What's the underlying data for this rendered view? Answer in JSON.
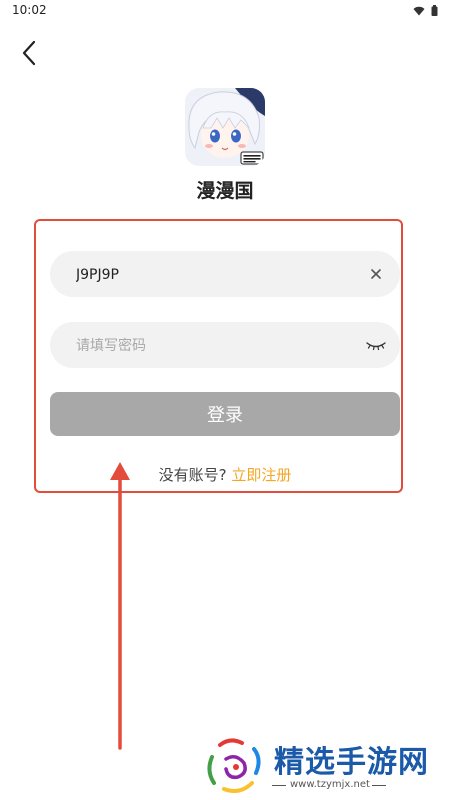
{
  "status_bar": {
    "time": "10:02",
    "icons": [
      "wifi-icon",
      "battery-icon"
    ]
  },
  "nav": {
    "back_icon": "chevron-left-icon"
  },
  "app": {
    "name": "漫漫国",
    "logo_badge": "漫漫国"
  },
  "login_form": {
    "account_value": "J9PJ9P",
    "password_placeholder": "请填写密码",
    "login_label": "登录",
    "no_account_text": "没有账号?",
    "register_label": "立即注册"
  },
  "annotation": {
    "box_color": "#e34b3b",
    "arrow_color": "#e34b3b"
  },
  "watermark": {
    "title": "精选手游网",
    "url": "www.tzymjx.net"
  },
  "colors": {
    "accent": "#f5a623",
    "button_disabled": "#a8a8a8",
    "field_bg": "#f2f2f2"
  }
}
